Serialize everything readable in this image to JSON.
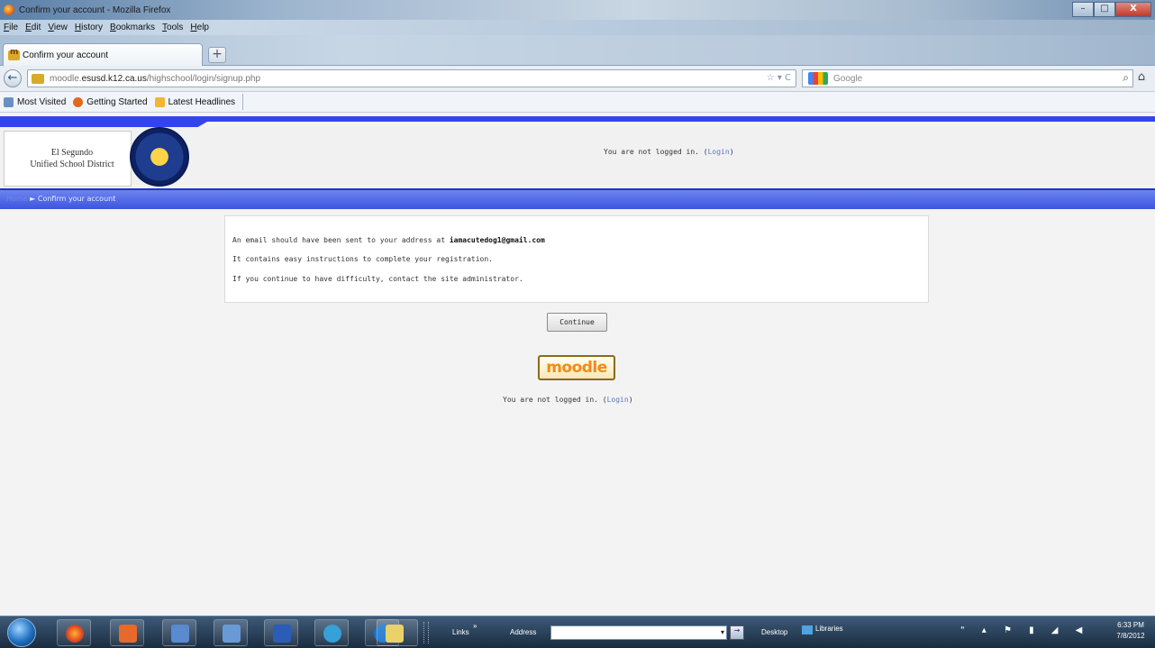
{
  "window": {
    "title": "Confirm your account - Mozilla Firefox",
    "minimize": "–",
    "maximize": "□",
    "close": "X"
  },
  "menu": [
    "File",
    "Edit",
    "View",
    "History",
    "Bookmarks",
    "Tools",
    "Help"
  ],
  "tab": {
    "label": "Confirm your account",
    "new_tab": "+"
  },
  "nav": {
    "back": "←",
    "url_prefix": "moodle.",
    "url_domain": "esusd.k12.ca.us",
    "url_path": "/highschool/login/signup.php",
    "url_right": "☆ ▾ C",
    "search_placeholder": "Google",
    "search_button": "⌕",
    "home": "⌂"
  },
  "bookmarks": [
    {
      "label": "Most Visited",
      "color": "#6b8fc4"
    },
    {
      "label": "Getting Started",
      "color": "#e06a1b"
    },
    {
      "label": "Latest Headlines",
      "color": "#f2b632"
    }
  ],
  "header": {
    "logo_line1": "El Segundo",
    "logo_line2": "Unified School District",
    "login_prefix": "You are not logged in. (",
    "login_link": "Login",
    "login_suffix": ")"
  },
  "breadcrumb": {
    "home": "Home",
    "sep": "►",
    "current": "Confirm your account"
  },
  "message": {
    "line1_prefix": "An email should have been sent to your address at ",
    "email": "iamacutedog1@gmail.com",
    "line2": "It contains easy instructions to complete your registration.",
    "line3": "If you continue to have difficulty, contact the site administrator."
  },
  "continue_label": "Continue",
  "moodle_logo": "moodle",
  "footer": {
    "login_prefix": "You are not logged in. (",
    "login_link": "Login",
    "login_suffix": ")"
  },
  "taskbar": {
    "links": "Links",
    "links_chevron": "»",
    "address": "Address",
    "address_dropdown": "▾",
    "go": "→",
    "desktop": "Desktop",
    "libraries": "Libraries",
    "tray": "\" ▴ ⚑ ▮ ◢ ◀",
    "time": "6:33 PM",
    "date": "7/8/2012"
  },
  "colors": {
    "page_bg": "#f3f3f3",
    "nav_blue": "#3d54e0",
    "link": "#5577cc",
    "moodle_orange": "#f28a1a"
  }
}
